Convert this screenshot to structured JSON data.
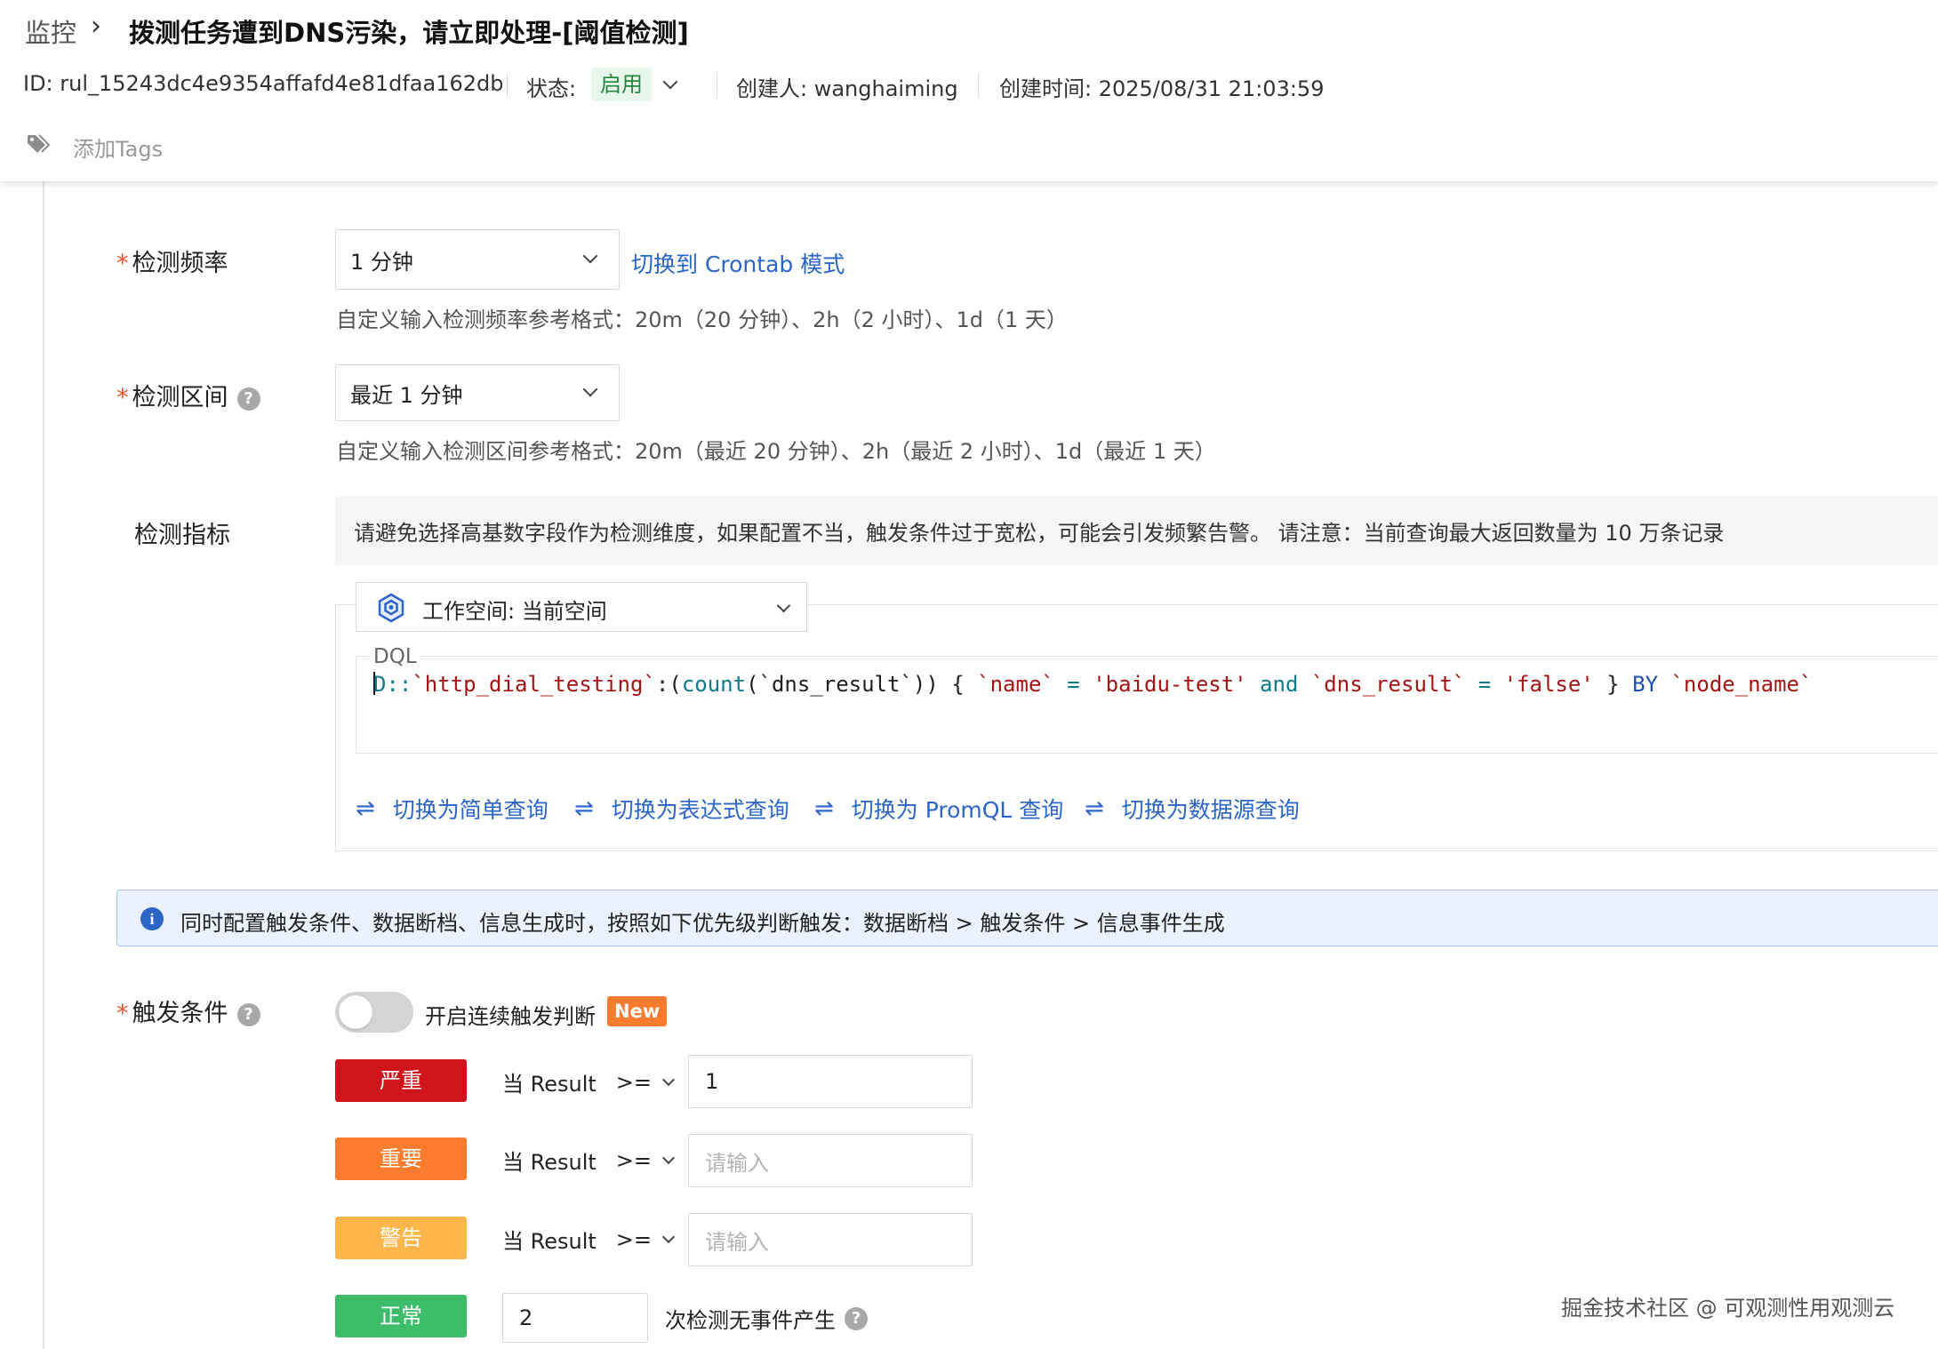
{
  "header": {
    "breadcrumb_root": "监控",
    "breadcrumb_sep": "›",
    "title": "拨测任务遭到DNS污染，请立即处理-[阈值检测]",
    "id_text": "ID: rul_15243dc4e9354affafd4e81dfaa162db",
    "status_label": "状态:",
    "status_value": "启用",
    "creator": "创建人: wanghaiming",
    "created_time": "创建时间: 2025/08/31 21:03:59",
    "add_tags": "添加Tags"
  },
  "form": {
    "frequency": {
      "label": "检测频率",
      "value": "1 分钟",
      "switch_link": "切换到 Crontab 模式",
      "hint": "自定义输入检测频率参考格式：20m（20 分钟）、2h（2 小时）、1d（1 天）"
    },
    "interval": {
      "label": "检测区间",
      "value": "最近 1 分钟",
      "hint": "自定义输入检测区间参考格式：20m（最近 20 分钟）、2h（最近 2 小时）、1d（最近 1 天）"
    },
    "metric": {
      "label": "检测指标",
      "warning": "请避免选择高基数字段作为检测维度，如果配置不当，触发条件过于宽松，可能会引发频繁告警。 请注意：当前查询最大返回数量为 10 万条记录",
      "workspace": "工作空间: 当前空间",
      "dql_label": "DQL",
      "code": {
        "t1": "D",
        "t2": "::",
        "t3": "`http_dial_testing`",
        "t4": ":(",
        "t5": "count",
        "t6": "(`dns_result`)) { ",
        "t7": "`name`",
        "t8": " = ",
        "t9": "'baidu-test'",
        "t10": " and ",
        "t11": "`dns_result`",
        "t12": " = ",
        "t13": "'false'",
        "t14": " } ",
        "t15": "BY",
        "t16": " ",
        "t17": "`node_name`"
      },
      "switches": [
        "切换为简单查询",
        "切换为表达式查询",
        "切换为 PromQL 查询",
        "切换为数据源查询"
      ],
      "switch_icon": "⇌"
    },
    "info_banner": "同时配置触发条件、数据断档、信息生成时，按照如下优先级判断触发：数据断档 > 触发条件 > 信息事件生成",
    "info_icon": "i",
    "trigger": {
      "label": "触发条件",
      "toggle_label": "开启连续触发判断",
      "toggle_on": false,
      "new_badge": "New",
      "rows": [
        {
          "level": "严重",
          "color": "#d0141b",
          "cond": "当 Result",
          "op": ">=",
          "value": "1",
          "placeholder": "请输入"
        },
        {
          "level": "重要",
          "color": "#fb7b2f",
          "cond": "当 Result",
          "op": ">=",
          "value": "",
          "placeholder": "请输入"
        },
        {
          "level": "警告",
          "color": "#fdb64a",
          "cond": "当 Result",
          "op": ">=",
          "value": "",
          "placeholder": "请输入"
        }
      ],
      "normal": {
        "level": "正常",
        "color": "#3dbd6a",
        "value": "2",
        "suffix": "次检测无事件产生"
      }
    },
    "help_icon": "?"
  },
  "watermark": "掘金技术社区 @ 可观测性用观测云"
}
